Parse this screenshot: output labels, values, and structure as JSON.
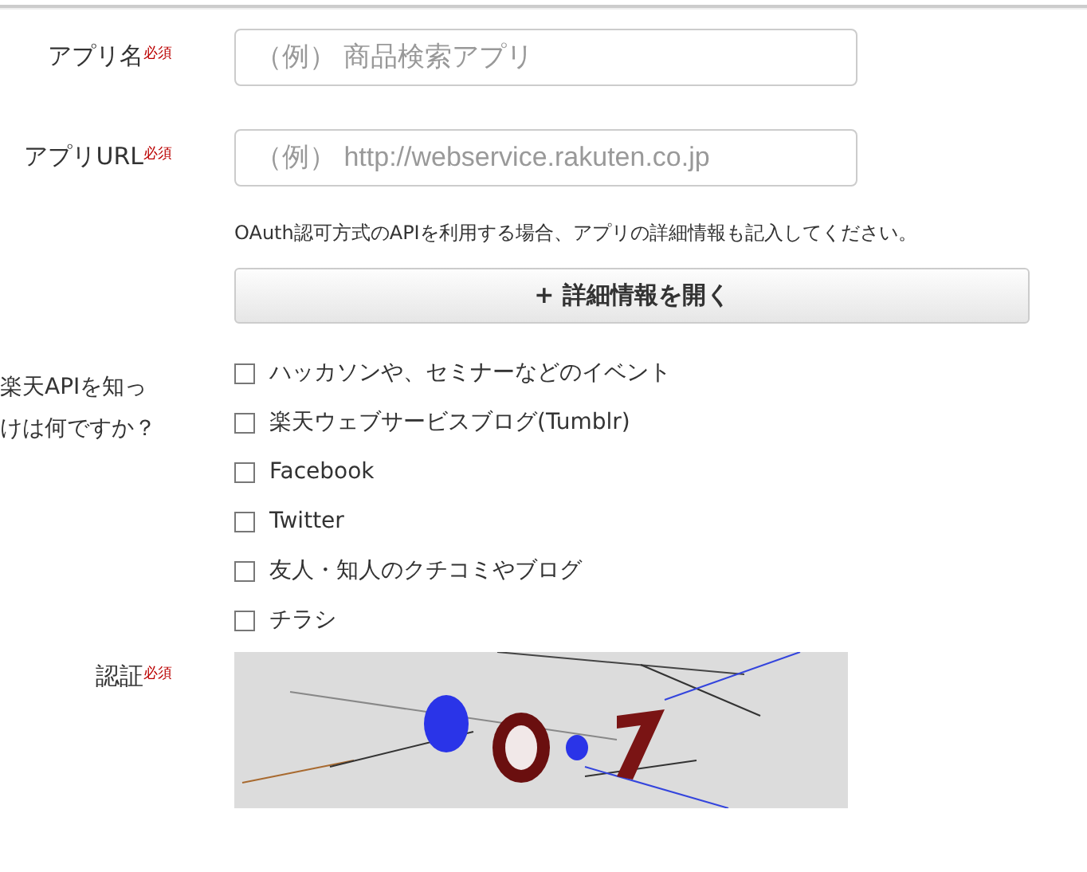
{
  "fields": [
    {
      "label": "アプリ名",
      "required": "必須",
      "placeholder": "（例） 商品検索アプリ"
    },
    {
      "label": "アプリURL",
      "required": "必須",
      "placeholder": "（例） http://webservice.rakuten.co.jp"
    }
  ],
  "oauth_note": "OAuth認可方式のAPIを利用する場合、アプリの詳細情報も記入してください。",
  "details_button": "+ 詳細情報を開く",
  "source_question": {
    "lines": [
      "楽天APIを知っ",
      "けは何ですか？"
    ],
    "options": [
      {
        "label": "ハッカソンや、セミナーなどのイベント",
        "checked": false
      },
      {
        "label": "楽天ウェブサービスブログ(Tumblr)",
        "checked": false
      },
      {
        "label": "Facebook",
        "checked": false
      },
      {
        "label": "Twitter",
        "checked": false
      },
      {
        "label": "友人・知人のクチコミやブログ",
        "checked": false
      },
      {
        "label": "チラシ",
        "checked": false
      }
    ]
  },
  "captcha": {
    "label": "認証",
    "required": "必須",
    "kind": "picture"
  }
}
